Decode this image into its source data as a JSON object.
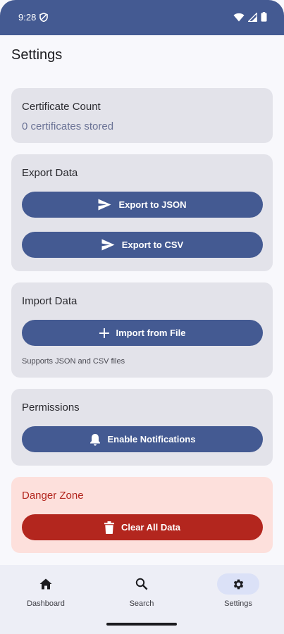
{
  "status_bar": {
    "time": "9:28"
  },
  "page": {
    "title": "Settings"
  },
  "certificate_card": {
    "title": "Certificate Count",
    "count_text": "0 certificates stored"
  },
  "export_card": {
    "title": "Export Data",
    "json_button": "Export to JSON",
    "csv_button": "Export to CSV"
  },
  "import_card": {
    "title": "Import Data",
    "import_button": "Import from File",
    "hint": "Supports JSON and CSV files"
  },
  "permissions_card": {
    "title": "Permissions",
    "notifications_button": "Enable Notifications"
  },
  "danger_card": {
    "title": "Danger Zone",
    "clear_button": "Clear All Data"
  },
  "nav": {
    "items": [
      {
        "label": "Dashboard",
        "icon": "home-icon"
      },
      {
        "label": "Search",
        "icon": "search-icon"
      },
      {
        "label": "Settings",
        "icon": "gear-icon",
        "active": true
      }
    ]
  },
  "colors": {
    "primary": "#445a92",
    "danger": "#b3261e",
    "danger_surface": "#fde0dc",
    "card_surface": "#e3e3ea"
  }
}
